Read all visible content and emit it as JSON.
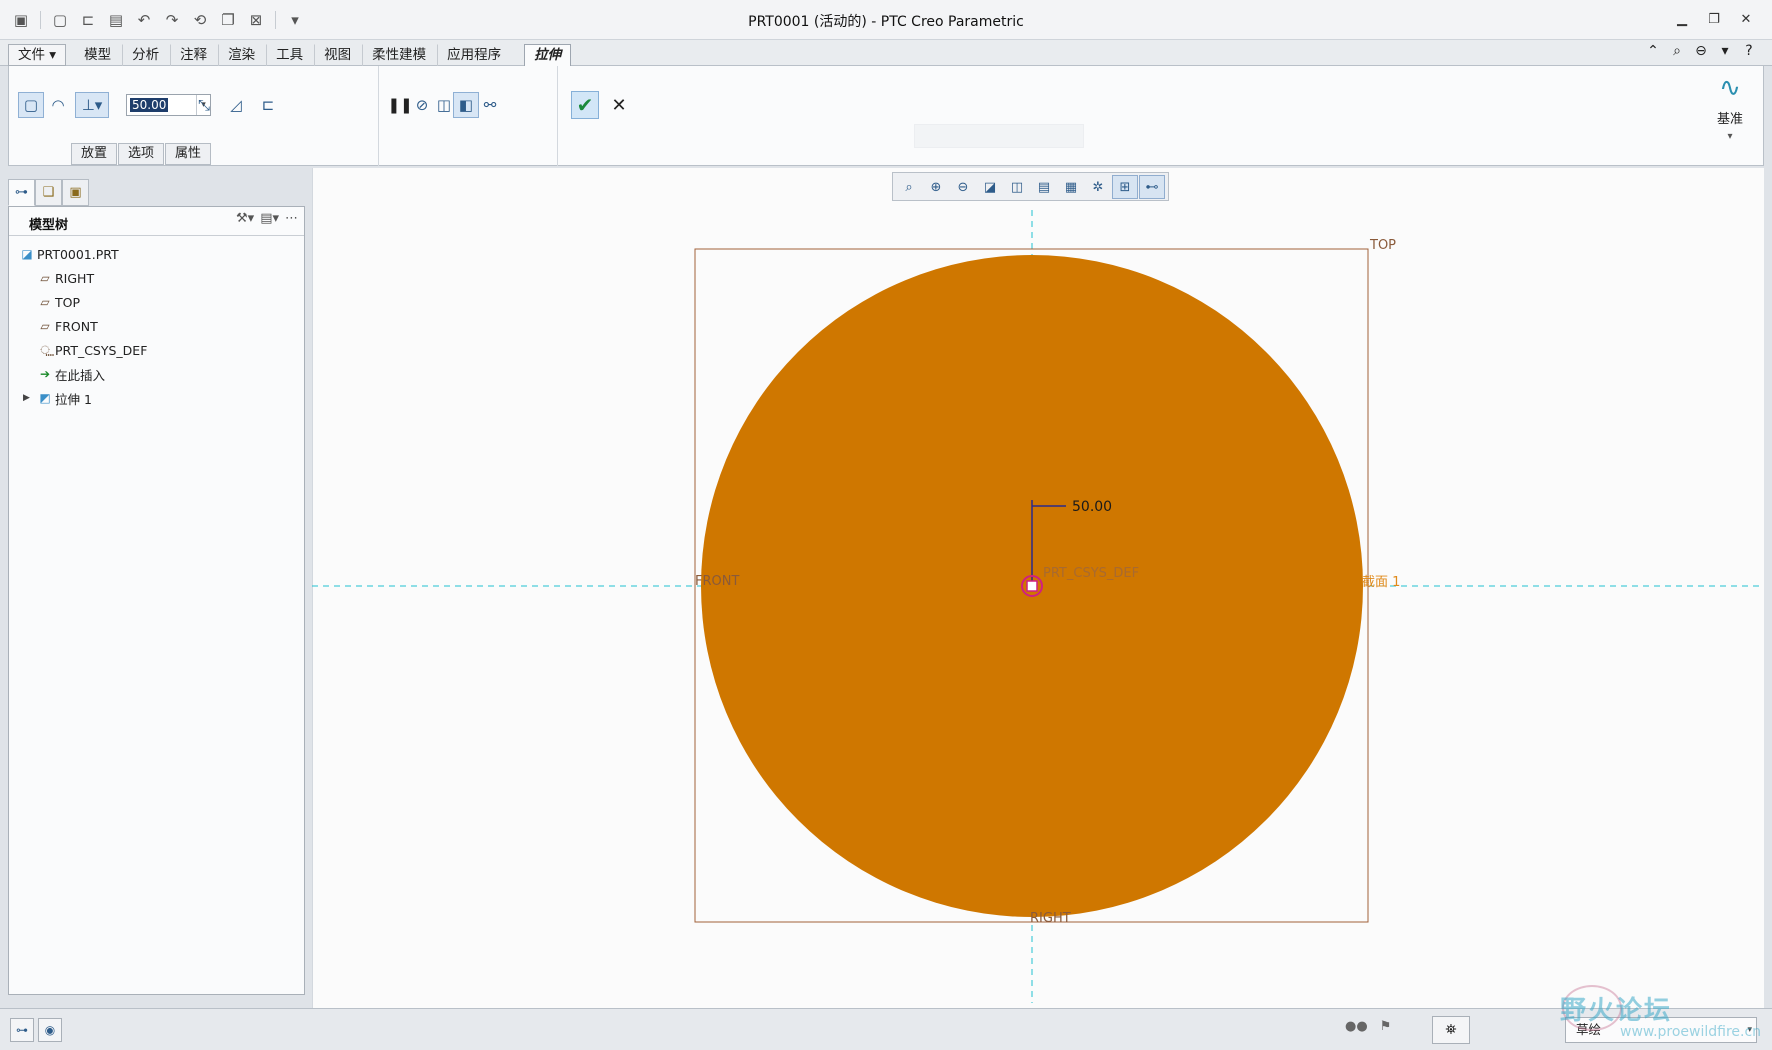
{
  "window": {
    "title": "PRT0001 (活动的) - PTC Creo Parametric"
  },
  "colors": {
    "feature_fill": "#cf7700",
    "datum_plane": "#a0603a",
    "axis_line": "#22c0d0",
    "section_label": "#e08a1a",
    "dimension": "#2a2a8a"
  },
  "quick_access": {
    "icons": [
      "app-icon",
      "new-icon",
      "open-icon",
      "save-icon",
      "undo-icon",
      "redo-icon",
      "regenerate-icon",
      "windows-icon",
      "close-window-icon",
      "customize-icon"
    ]
  },
  "ribbon": {
    "tabs": [
      {
        "label": "文件"
      },
      {
        "label": "模型"
      },
      {
        "label": "分析"
      },
      {
        "label": "注释"
      },
      {
        "label": "渲染"
      },
      {
        "label": "工具"
      },
      {
        "label": "视图"
      },
      {
        "label": "柔性建模"
      },
      {
        "label": "应用程序"
      },
      {
        "label": "拉伸"
      }
    ],
    "active_tab": "拉伸",
    "depth_value": "50.00",
    "slideup_tabs": [
      {
        "label": "放置"
      },
      {
        "label": "选项"
      },
      {
        "label": "属性"
      }
    ],
    "datum_label": "基准"
  },
  "model_tree": {
    "title": "模型树",
    "root": "PRT0001.PRT",
    "items": [
      {
        "label": "RIGHT",
        "icon": "datum-plane-icon"
      },
      {
        "label": "TOP",
        "icon": "datum-plane-icon"
      },
      {
        "label": "FRONT",
        "icon": "datum-plane-icon"
      },
      {
        "label": "PRT_CSYS_DEF",
        "icon": "csys-icon"
      },
      {
        "label": "在此插入",
        "icon": "insert-arrow-icon"
      },
      {
        "label": "拉伸 1",
        "icon": "extrude-feature-icon"
      }
    ]
  },
  "graphics": {
    "labels": {
      "top": "TOP",
      "front": "FRONT",
      "right": "RIGHT",
      "csys": "PRT_CSYS_DEF",
      "section": "截面 1",
      "dimension": "50.00"
    }
  },
  "status": {
    "filter": "草绘"
  },
  "watermark": {
    "name": "野火论坛",
    "url": "www.proewildfire.cn"
  }
}
